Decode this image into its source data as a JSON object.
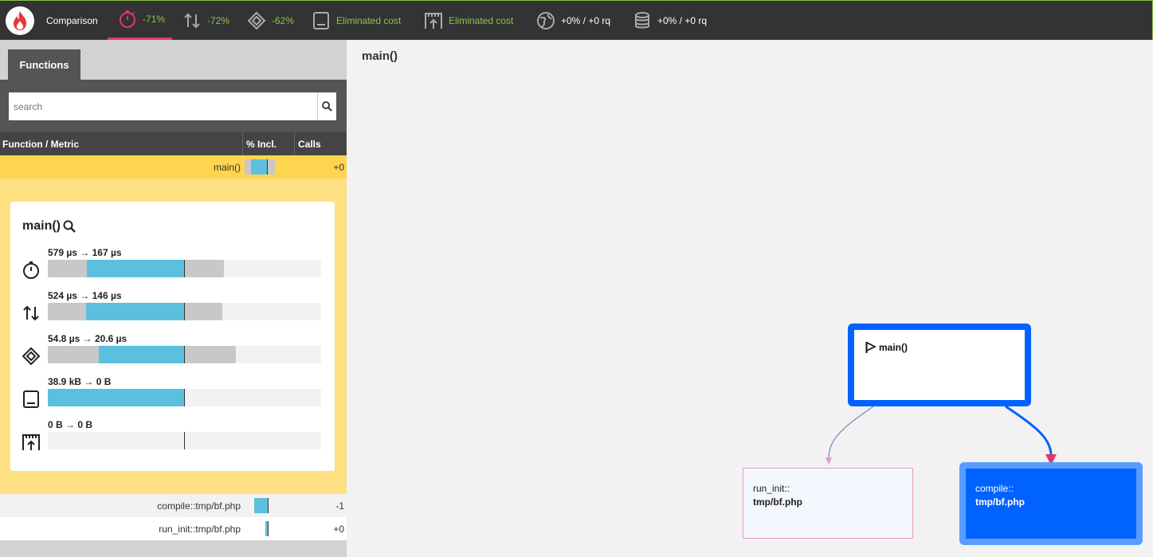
{
  "topbar": {
    "comparison_label": "Comparison",
    "wall_time": "-71%",
    "io": "-72%",
    "cpu": "-62%",
    "memory": "Eliminated cost",
    "peak_memory": "Eliminated cost",
    "network": "+0% / +0 rq",
    "sql": "+0% / +0 rq"
  },
  "sidebar": {
    "tab_label": "Functions",
    "search_placeholder": "search",
    "columns": [
      "Function / Metric",
      "% Incl.",
      "Calls"
    ],
    "rows": [
      {
        "name": "main()",
        "calls": "+0",
        "incl_grey": 0.11,
        "incl_blue": 0.06
      },
      {
        "name": "compile::tmp/bf.php",
        "calls": "-1",
        "incl_blue": 0.05
      },
      {
        "name": "run_init::tmp/bf.php",
        "calls": "+0",
        "incl_blue": 0.01
      }
    ]
  },
  "detail": {
    "title": "main()",
    "metrics": [
      {
        "icon": "stopwatch-icon",
        "label": "579 µs → 167 µs"
      },
      {
        "icon": "io-arrows-icon",
        "label": "524 µs → 146 µs"
      },
      {
        "icon": "cpu-icon",
        "label": "54.8 µs → 20.6 µs"
      },
      {
        "icon": "memory-icon",
        "label": "38.9 kB → 0 B"
      },
      {
        "icon": "peak-memory-icon",
        "label": "0 B → 0 B"
      }
    ]
  },
  "graph": {
    "title": "main()",
    "nodes": {
      "main": "main()",
      "run_init_line1": "run_init::",
      "run_init_line2": "tmp/bf.php",
      "compile_line1": "compile::",
      "compile_line2": "tmp/bf.php"
    }
  },
  "colors": {
    "accent_pink": "#e2376b",
    "green": "#8bc34a",
    "bar_blue": "#5bc0de",
    "node_blue": "#0062ff",
    "highlight_yellow": "#ffd54f"
  }
}
